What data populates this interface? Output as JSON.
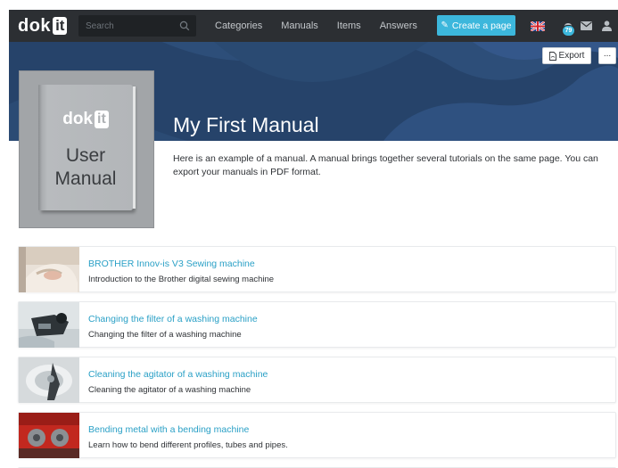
{
  "navbar": {
    "logo_text": "dok",
    "logo_box": "it",
    "search_placeholder": "Search",
    "links": [
      "Categories",
      "Manuals",
      "Items",
      "Answers"
    ],
    "create_label": "Create a page",
    "notification_count": "79",
    "language": "English",
    "icons": [
      "search-icon",
      "pencil-icon",
      "uk-flag-icon",
      "bell-icon",
      "mail-icon",
      "user-icon"
    ]
  },
  "header": {
    "export_label": "Export",
    "more_label": "..."
  },
  "cover": {
    "logo_text": "dok",
    "logo_box": "it",
    "line1": "User",
    "line2": "Manual"
  },
  "manual": {
    "title": "My First Manual",
    "description": "Here is an example of a manual. A manual brings together several tutorials on the same page. You can export your manuals in PDF format."
  },
  "tutorials": [
    {
      "title": "BROTHER Innov-is V3 Sewing machine",
      "subtitle": "Introduction to the Brother digital sewing machine"
    },
    {
      "title": "Changing the filter of a washing machine",
      "subtitle": "Changing the filter of a washing machine"
    },
    {
      "title": "Cleaning the agitator of a washing machine",
      "subtitle": "Cleaning the agitator of a washing machine"
    },
    {
      "title": "Bending metal with a bending machine",
      "subtitle": "Learn how to bend different profiles, tubes and pipes."
    }
  ],
  "colors": {
    "navbar": "#2c2f33",
    "accent": "#3cb7dc",
    "hero": "#26436a",
    "link": "#2aa0c6"
  }
}
